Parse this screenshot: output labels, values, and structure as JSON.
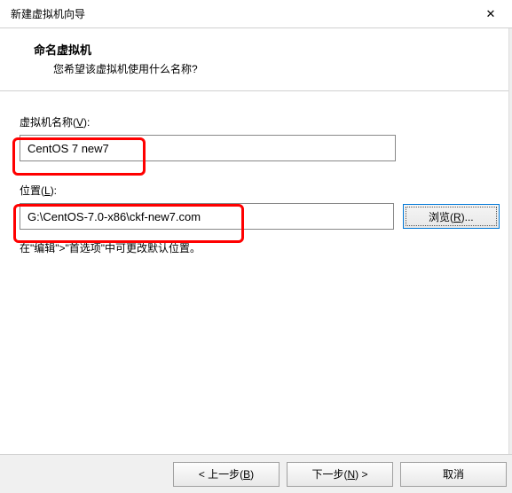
{
  "titlebar": {
    "title": "新建虚拟机向导",
    "close_glyph": "✕"
  },
  "header": {
    "title": "命名虚拟机",
    "subtitle": "您希望该虚拟机使用什么名称?"
  },
  "form": {
    "name_label_pre": "虚拟机名称(",
    "name_label_u": "V",
    "name_label_post": "):",
    "name_value": "CentOS 7 new7",
    "location_label_pre": "位置(",
    "location_label_u": "L",
    "location_label_post": "):",
    "location_value": "G:\\CentOS-7.0-x86\\ckf-new7.com",
    "browse_pre": "浏览(",
    "browse_u": "R",
    "browse_post": ")...",
    "hint": "在\"编辑\">\"首选项\"中可更改默认位置。"
  },
  "footer": {
    "back_pre": "< 上一步(",
    "back_u": "B",
    "back_post": ")",
    "next_pre": "下一步(",
    "next_u": "N",
    "next_post": ") >",
    "cancel": "取消"
  }
}
